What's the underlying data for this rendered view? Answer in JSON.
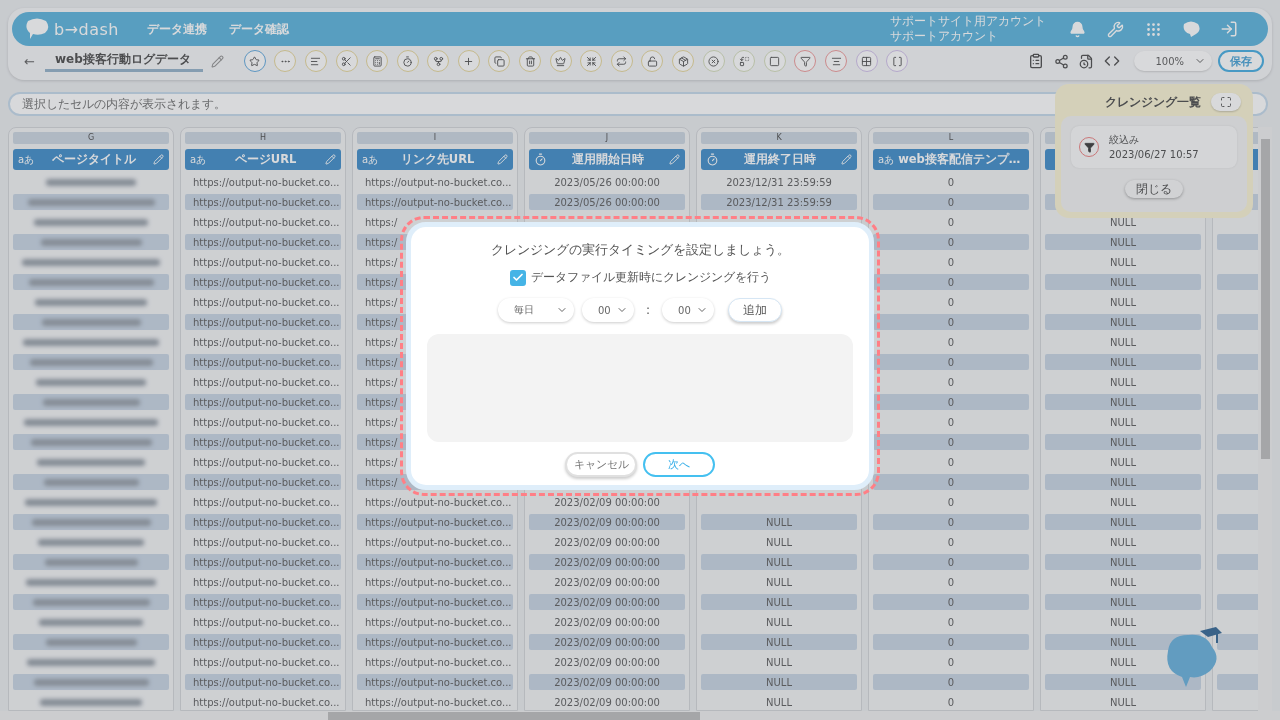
{
  "header": {
    "logo": "b→dash",
    "nav": [
      {
        "label": "データ連携"
      },
      {
        "label": "データ確認"
      }
    ],
    "account": {
      "site": "サポートサイト用アカウント",
      "name": "サポートアカウント"
    }
  },
  "toolbar": {
    "back": "←",
    "title": "web接客行動ログデータ",
    "zoom": "100%",
    "save": "保存"
  },
  "cell_bar": {
    "placeholder": "選択したセルの内容が表示されます。"
  },
  "table": {
    "columns": [
      {
        "letter": "G",
        "title": "ページタイトル",
        "kind": "text",
        "type_mark": "aあ",
        "blurred": true
      },
      {
        "letter": "H",
        "title": "ページURL",
        "kind": "text",
        "type_mark": "aあ",
        "cells": [
          "https://output-no-bucket.co...",
          "https://output-no-bucket.co...",
          "https://output-no-bucket.co...",
          "https://output-no-bucket.co...",
          "https://output-no-bucket.co...",
          "https://output-no-bucket.co...",
          "https://output-no-bucket.co...",
          "https://output-no-bucket.co...",
          "https://output-no-bucket.co...",
          "https://output-no-bucket.co...",
          "https://output-no-bucket.co...",
          "https://output-no-bucket.co...",
          "https://output-no-bucket.co...",
          "https://output-no-bucket.co...",
          "https://output-no-bucket.co...",
          "https://output-no-bucket.co...",
          "https://output-no-bucket.co...",
          "https://output-no-bucket.co...",
          "https://output-no-bucket.co...",
          "https://output-no-bucket.co...",
          "https://output-no-bucket.co...",
          "https://output-no-bucket.co...",
          "https://output-no-bucket.co...",
          "https://output-no-bucket.co...",
          "https://output-no-bucket.co...",
          "https://output-no-bucket.co...",
          "https://output-no-bucket.co..."
        ]
      },
      {
        "letter": "I",
        "title": "リンク先URL",
        "kind": "text",
        "type_mark": "aあ",
        "cells": [
          "https://output-no-bucket.co...",
          "https://output-no-bucket.co...",
          "https:/",
          "https:/",
          "https:/",
          "https:/",
          "https:/",
          "https:/",
          "https:/",
          "https:/",
          "https:/",
          "https:/",
          "https:/",
          "https:/",
          "https:/",
          "https:/",
          "https://output-no-bucket.co...",
          "https://output-no-bucket.co...",
          "https://output-no-bucket.co...",
          "https://output-no-bucket.co...",
          "https://output-no-bucket.co...",
          "https://output-no-bucket.co...",
          "https://output-no-bucket.co...",
          "https://output-no-bucket.co...",
          "https://output-no-bucket.co...",
          "https://output-no-bucket.co...",
          "https://output-no-bucket.co..."
        ]
      },
      {
        "letter": "J",
        "title": "運用開始日時",
        "kind": "datetime",
        "cells": [
          "2023/05/26 00:00:00",
          "2023/05/26 00:00:00",
          null,
          null,
          null,
          null,
          null,
          null,
          null,
          null,
          null,
          null,
          null,
          null,
          null,
          null,
          "2023/02/09 00:00:00",
          "2023/02/09 00:00:00",
          "2023/02/09 00:00:00",
          "2023/02/09 00:00:00",
          "2023/02/09 00:00:00",
          "2023/02/09 00:00:00",
          "2023/02/09 00:00:00",
          "2023/02/09 00:00:00",
          "2023/02/09 00:00:00",
          "2023/02/09 00:00:00",
          "2023/02/09 00:00:00"
        ]
      },
      {
        "letter": "K",
        "title": "運用終了日時",
        "kind": "datetime",
        "cells": [
          "2023/12/31 23:59:59",
          "2023/12/31 23:59:59",
          null,
          null,
          null,
          null,
          null,
          null,
          null,
          null,
          null,
          null,
          null,
          null,
          null,
          null,
          null,
          "NULL",
          "NULL",
          "NULL",
          "NULL",
          "NULL",
          "NULL",
          "NULL",
          "NULL",
          "NULL",
          "NULL"
        ]
      },
      {
        "letter": "L",
        "title": "web接客配信テンプ…",
        "kind": "text",
        "type_mark": "aあ",
        "cells": [
          "0",
          "0",
          "0",
          "0",
          "0",
          "0",
          "0",
          "0",
          "0",
          "0",
          "0",
          "0",
          "0",
          "0",
          "0",
          "0",
          "0",
          "0",
          "0",
          "0",
          "0",
          "0",
          "0",
          "0",
          "0",
          "0",
          "0"
        ]
      },
      {
        "kind": "text",
        "cells": [
          null,
          null,
          "NULL",
          "NULL",
          "NULL",
          "NULL",
          "NULL",
          "NULL",
          "NULL",
          "NULL",
          "NULL",
          "NULL",
          "NULL",
          "NULL",
          "NULL",
          "NULL",
          "NULL",
          "NULL",
          "NULL",
          "NULL",
          "NULL",
          "NULL",
          "NULL",
          "NULL",
          "NULL",
          "NULL",
          "NULL"
        ]
      },
      {
        "kind": "text",
        "cells": [
          null,
          null,
          null,
          null,
          null,
          null,
          null,
          null,
          null,
          null,
          null,
          null,
          null,
          null,
          null,
          null,
          null,
          null,
          null,
          null,
          null,
          null,
          null,
          null,
          null,
          null,
          null
        ]
      }
    ]
  },
  "cleansing_panel": {
    "title": "クレンジング一覧",
    "items": [
      {
        "name": "絞込み",
        "date": "2023/06/27 10:57"
      }
    ],
    "close": "閉じる"
  },
  "dialog": {
    "title": "クレンジングの実行タイミングを設定しましょう。",
    "checkbox": {
      "label": "データファイル更新時にクレンジングを行う",
      "checked": true
    },
    "schedule": {
      "frequency": "毎日",
      "hour": "00",
      "separator": ":",
      "minute": "00",
      "add": "追加"
    },
    "buttons": [
      {
        "label": "キャンセル",
        "kind": "secondary"
      },
      {
        "label": "次へ",
        "kind": "primary"
      }
    ]
  }
}
